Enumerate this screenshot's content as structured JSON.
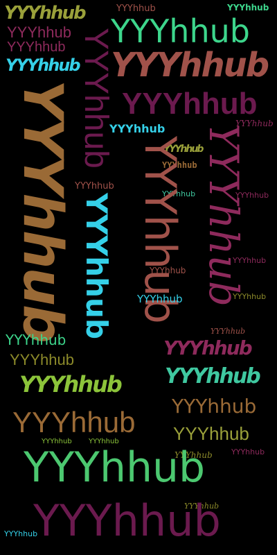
{
  "word": "YYYhhub",
  "colors": {
    "background": "#000000",
    "dark_magenta": "#6b1a4e",
    "mint_green": "#3dd68c",
    "terracotta": "#a0524a",
    "ochre": "#9a6a36",
    "cyan": "#35d0e8",
    "olive": "#8c8a2a",
    "teal_green": "#3fc8a0",
    "lime": "#8cc43a",
    "light_green": "#4cc870",
    "rose": "#8e2a5c",
    "khaki": "#9aa03a"
  }
}
